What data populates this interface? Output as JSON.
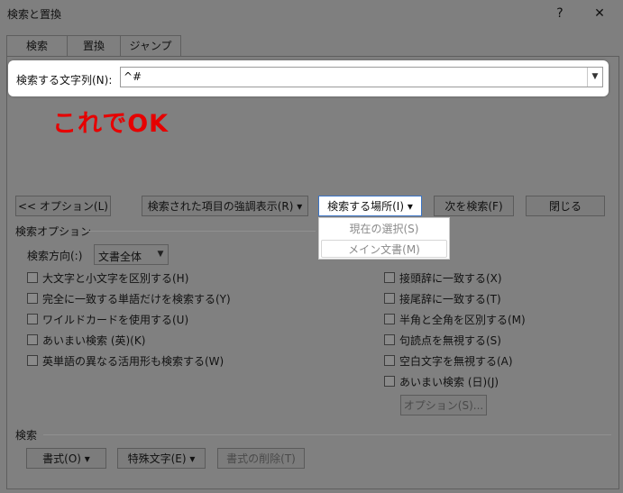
{
  "window": {
    "title": "検索と置換",
    "help_label": "?",
    "close_label": "✕"
  },
  "tabs": [
    {
      "label": "検索",
      "active": true
    },
    {
      "label": "置換",
      "active": false
    },
    {
      "label": "ジャンプ",
      "active": false
    }
  ],
  "find": {
    "label": "検索する文字列(N):",
    "value": "^#"
  },
  "annotation": {
    "text": "これでOK",
    "color": "#e60000"
  },
  "buttons": {
    "options": "<< オプション(L)",
    "highlight": "検索された項目の強調表示(R) ▾",
    "find_in": "検索する場所(I) ▾",
    "find_next": "次を検索(F)",
    "close": "閉じる"
  },
  "find_in_menu": {
    "items": [
      {
        "label": "現在の選択(S)",
        "selected": false
      },
      {
        "label": "メイン文書(M)",
        "selected": true
      }
    ]
  },
  "search_options": {
    "heading": "検索オプション",
    "direction_label": "検索方向(:)",
    "direction_value": "文書全体",
    "left_checks": [
      "大文字と小文字を区別する(H)",
      "完全に一致する単語だけを検索する(Y)",
      "ワイルドカードを使用する(U)",
      "あいまい検索 (英)(K)",
      "英単語の異なる活用形も検索する(W)"
    ],
    "right_checks": [
      "接頭辞に一致する(X)",
      "接尾辞に一致する(T)",
      "半角と全角を区別する(M)",
      "句読点を無視する(S)",
      "空白文字を無視する(A)",
      "あいまい検索 (日)(J)"
    ],
    "jp_options_button": "オプション(S)..."
  },
  "bottom": {
    "heading": "検索",
    "format_button": "書式(O) ▾",
    "special_button": "特殊文字(E) ▾",
    "clear_format_button": "書式の削除(T)"
  },
  "colors": {
    "dialog_bg": "#7f7f7f",
    "highlight_band": "#ffffff",
    "annotation": "#e60000",
    "active_button_border": "#3b74c5"
  }
}
